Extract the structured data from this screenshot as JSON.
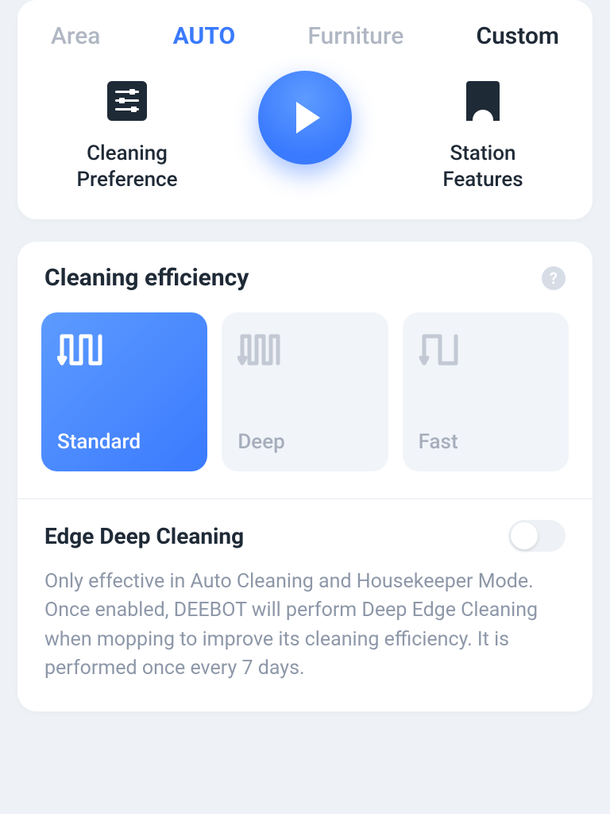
{
  "tabs": {
    "area": "Area",
    "auto": "AUTO",
    "furniture": "Furniture",
    "custom": "Custom"
  },
  "actions": {
    "preference_label": "Cleaning\nPreference",
    "station_label": "Station\nFeatures"
  },
  "efficiency": {
    "title": "Cleaning efficiency",
    "help": "?",
    "modes": {
      "standard": "Standard",
      "deep": "Deep",
      "fast": "Fast"
    },
    "selected": "standard"
  },
  "edge": {
    "title": "Edge Deep Cleaning",
    "enabled": false,
    "description": "Only effective in Auto Cleaning and Housekeeper Mode. Once enabled, DEEBOT will perform Deep Edge Cleaning when mopping to improve its cleaning efficiency. It is performed once every 7 days."
  }
}
